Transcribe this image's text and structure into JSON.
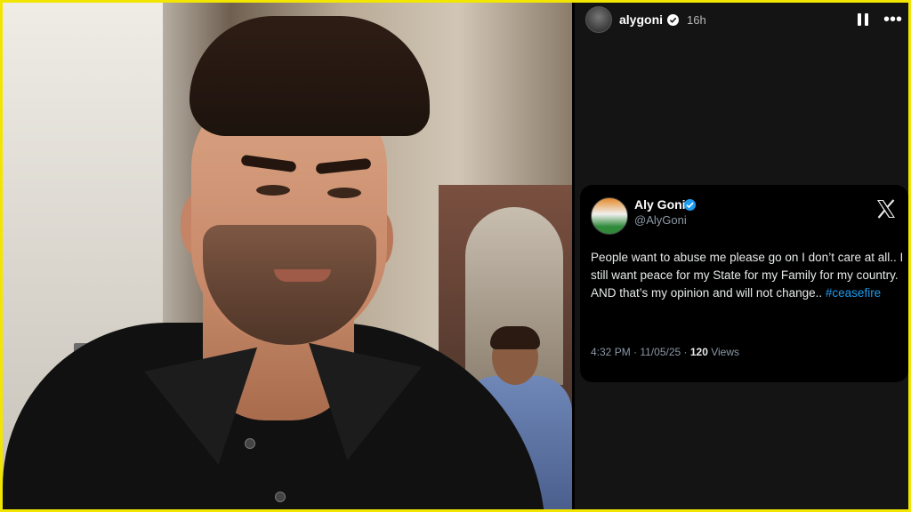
{
  "story": {
    "username": "alygoni",
    "time_ago": "16h",
    "icons": {
      "verified": "verified-icon",
      "pause": "pause-icon",
      "more": "more-options-icon"
    }
  },
  "tweet": {
    "name": "Aly Goni",
    "handle": "@AlyGoni",
    "text_before": "People want to abuse me please go on I don’t care at all.. I still want peace for my State for my Family for my country. AND that’s my opinion and will not change.. ",
    "hashtag": "#ceasefire",
    "time": "4:32 PM · 11/05/25 · ",
    "views_count": "120",
    "views_label": " Views",
    "icons": {
      "badge": "blue-verified-icon",
      "platform": "x-logo-icon"
    }
  },
  "colors": {
    "border": "#f2e600",
    "link": "#1d9bf0",
    "panel": "#141414"
  }
}
